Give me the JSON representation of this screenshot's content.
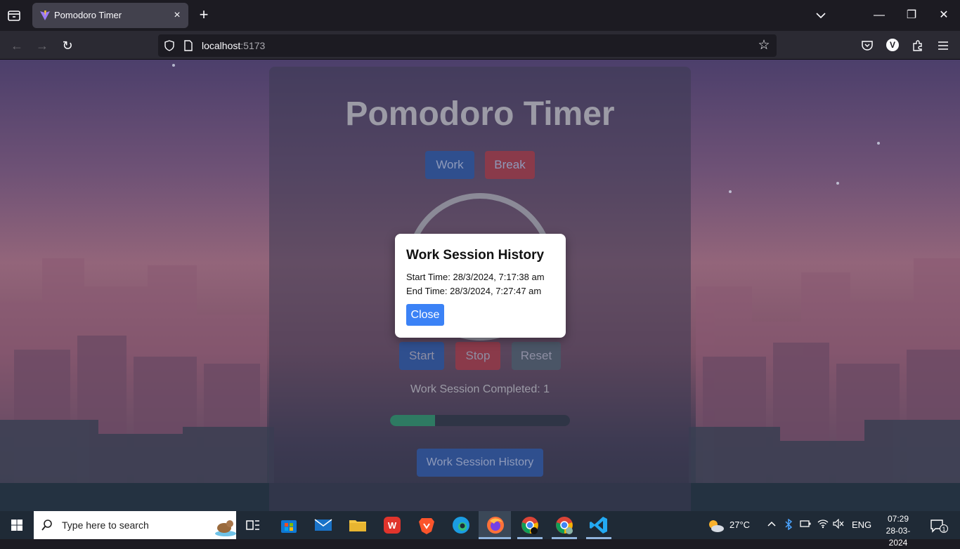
{
  "browser": {
    "tab": {
      "title": "Pomodoro Timer",
      "close_label": "×"
    },
    "new_tab_label": "+",
    "url": {
      "host": "localhost",
      "port": ":5173"
    },
    "profile_initial": "V",
    "window_controls": {
      "minimize": "—",
      "restore": "❐",
      "close": "✕"
    }
  },
  "app": {
    "title": "Pomodoro Timer",
    "modes": {
      "work": "Work",
      "break": "Break"
    },
    "controls": {
      "start": "Start",
      "stop": "Stop",
      "reset": "Reset"
    },
    "completed_text": "Work Session Completed: 1",
    "progress_percent": 25,
    "history_button": "Work Session History",
    "colors": {
      "work": "#2f4f8e",
      "break": "#8a3a4a",
      "stop": "#8a3a4a",
      "reset": "#4a5566",
      "progress": "#2e7a62"
    }
  },
  "modal": {
    "title": "Work Session History",
    "start_line": "Start Time: 28/3/2024, 7:17:38 am",
    "end_line": "End Time: 28/3/2024, 7:27:47 am",
    "close_label": "Close"
  },
  "taskbar": {
    "search_placeholder": "Type here to search",
    "weather": "27°C",
    "language": "ENG",
    "time": "07:29",
    "date": "28-03-2024",
    "notification_count": "1"
  }
}
